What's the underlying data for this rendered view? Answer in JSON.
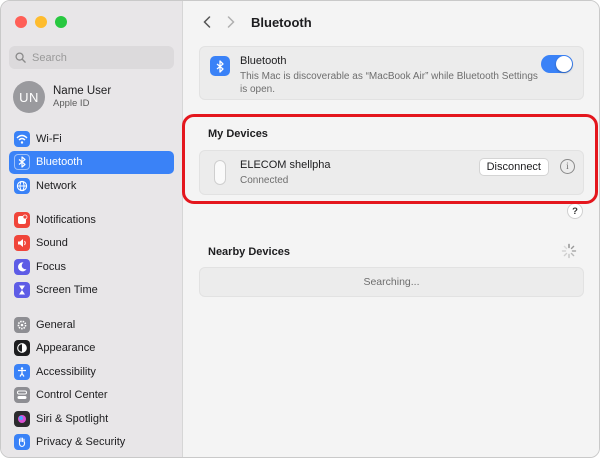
{
  "window": {
    "traffic_lights": {
      "close": "#ff5f57",
      "minimize": "#febc2e",
      "zoom": "#28c840"
    }
  },
  "sidebar": {
    "search_placeholder": "Search",
    "user": {
      "initials": "UN",
      "name": "Name User",
      "subtitle": "Apple ID"
    },
    "groups": [
      [
        {
          "label": "Wi-Fi",
          "icon": "wifi-icon",
          "color": "#3a82f7",
          "active": false
        },
        {
          "label": "Bluetooth",
          "icon": "bluetooth-icon",
          "color": "#3a82f7",
          "active": true
        },
        {
          "label": "Network",
          "icon": "globe-icon",
          "color": "#3a82f7",
          "active": false
        }
      ],
      [
        {
          "label": "Notifications",
          "icon": "bell-icon",
          "color": "#f0453a",
          "active": false
        },
        {
          "label": "Sound",
          "icon": "speaker-icon",
          "color": "#f0453a",
          "active": false
        },
        {
          "label": "Focus",
          "icon": "moon-icon",
          "color": "#5e5ce6",
          "active": false
        },
        {
          "label": "Screen Time",
          "icon": "hourglass-icon",
          "color": "#5e5ce6",
          "active": false
        }
      ],
      [
        {
          "label": "General",
          "icon": "gear-icon",
          "color": "#8e8e93",
          "active": false
        },
        {
          "label": "Appearance",
          "icon": "appearance-icon",
          "color": "#1d1d1f",
          "active": false
        },
        {
          "label": "Accessibility",
          "icon": "accessibility-icon",
          "color": "#3a82f7",
          "active": false
        },
        {
          "label": "Control Center",
          "icon": "control-center-icon",
          "color": "#8e8e93",
          "active": false
        },
        {
          "label": "Siri & Spotlight",
          "icon": "siri-icon",
          "color": "#2c2c2e",
          "active": false
        },
        {
          "label": "Privacy & Security",
          "icon": "hand-icon",
          "color": "#3a82f7",
          "active": false
        }
      ]
    ]
  },
  "toolbar": {
    "title": "Bluetooth"
  },
  "bluetooth": {
    "title": "Bluetooth",
    "description": "This Mac is discoverable as “MacBook Air” while Bluetooth Settings is open.",
    "enabled": true
  },
  "my_devices": {
    "heading": "My Devices",
    "devices": [
      {
        "name": "ELECOM shellpha",
        "status": "Connected",
        "action": "Disconnect"
      }
    ]
  },
  "help": {
    "label": "?"
  },
  "nearby": {
    "heading": "Nearby Devices",
    "status": "Searching..."
  },
  "accent": "#3a82f7",
  "highlight_color": "#e4161d"
}
